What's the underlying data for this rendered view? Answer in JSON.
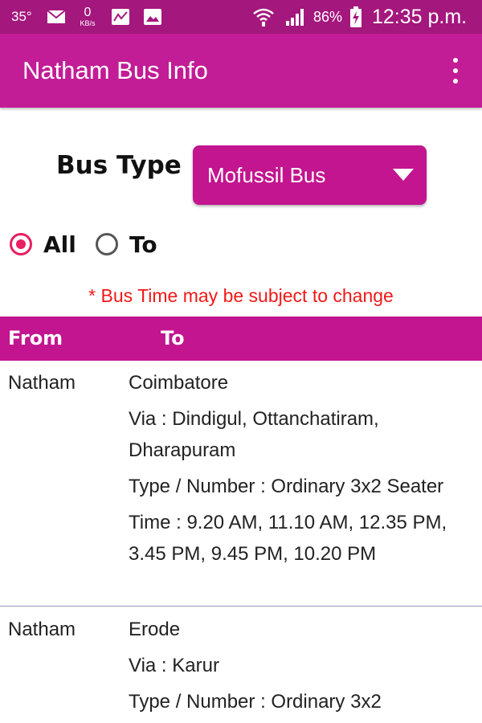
{
  "status_bar": {
    "temperature": "35°",
    "data_rate_value": "0",
    "data_rate_unit": "KB/s",
    "battery": "86%",
    "time": "12:35 p.m."
  },
  "app_bar": {
    "title": "Natham Bus Info",
    "overflow_icon": "more-vert-icon"
  },
  "filters": {
    "bus_type_label": "Bus Type",
    "bus_type_selected": "Mofussil Bus",
    "radio_all": "All",
    "radio_to": "To",
    "selected_radio": "All"
  },
  "notice": "* Bus Time may be subject to change",
  "table": {
    "headers": {
      "from": "From",
      "to": "To"
    },
    "rows": [
      {
        "from": "Natham",
        "to": "Coimbatore",
        "via": "Via : Dindigul, Ottanchatiram, Dharapuram",
        "type_number": "Type / Number :  Ordinary 3x2 Seater",
        "time": "Time : 9.20 AM,  11.10 AM,  12.35 PM,  3.45 PM,  9.45 PM,  10.20 PM"
      },
      {
        "from": "Natham",
        "to": "Erode",
        "via": "Via : Karur",
        "type_number": "Type / Number :  Ordinary 3x2"
      }
    ]
  },
  "colors": {
    "status_bar": "#a4177d",
    "app_bar": "#c21c96",
    "accent": "#c2158f",
    "radio": "#e91e63",
    "notice": "#f01818"
  }
}
